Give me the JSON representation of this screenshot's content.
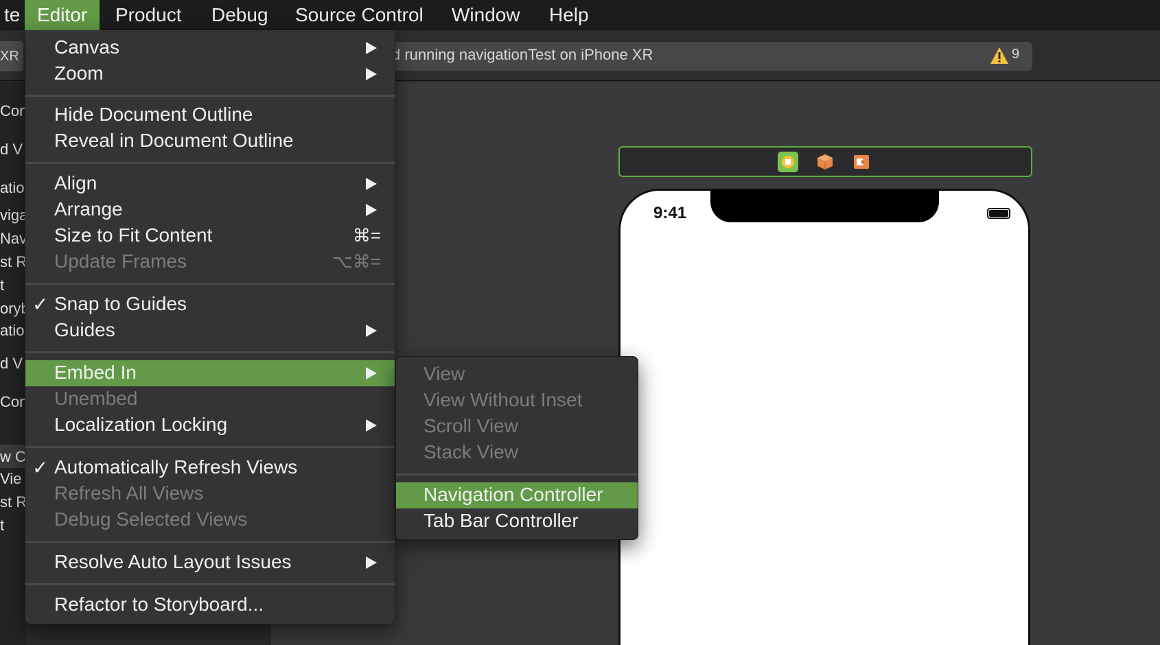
{
  "menubar": {
    "items": [
      {
        "label": "te"
      },
      {
        "label": "Editor"
      },
      {
        "label": "Product"
      },
      {
        "label": "Debug"
      },
      {
        "label": "Source Control"
      },
      {
        "label": "Window"
      },
      {
        "label": "Help"
      }
    ]
  },
  "toolbar": {
    "scheme_chip": "XR",
    "activity_text": "d running navigationTest on iPhone XR",
    "warning_count": "9"
  },
  "navigator": {
    "rows": [
      "Con",
      "d V",
      "atio",
      "viga",
      "Nav",
      "st R",
      "t",
      "oryb",
      "atio",
      "d V",
      "Con",
      "w C",
      "Vie",
      "st R",
      "t"
    ]
  },
  "editor_menu": {
    "items": [
      {
        "label": "Canvas",
        "submenu": true
      },
      {
        "label": "Zoom",
        "submenu": true
      },
      {
        "label": "Hide Document Outline"
      },
      {
        "label": "Reveal in Document Outline"
      },
      {
        "label": "Align",
        "submenu": true
      },
      {
        "label": "Arrange",
        "submenu": true
      },
      {
        "label": "Size to Fit Content",
        "shortcut": "⌘="
      },
      {
        "label": "Update Frames",
        "shortcut": "⌥⌘=",
        "disabled": true
      },
      {
        "label": "Snap to Guides",
        "checked": true
      },
      {
        "label": "Guides",
        "submenu": true
      },
      {
        "label": "Embed In",
        "submenu": true,
        "selected": true
      },
      {
        "label": "Unembed",
        "disabled": true
      },
      {
        "label": "Localization Locking",
        "submenu": true
      },
      {
        "label": "Automatically Refresh Views",
        "checked": true
      },
      {
        "label": "Refresh All Views",
        "disabled": true
      },
      {
        "label": "Debug Selected Views",
        "disabled": true
      },
      {
        "label": "Resolve Auto Layout Issues",
        "submenu": true
      },
      {
        "label": "Refactor to Storyboard..."
      }
    ],
    "checkmark": "✓"
  },
  "embed_submenu": {
    "items": [
      {
        "label": "View",
        "disabled": true
      },
      {
        "label": "View Without Inset",
        "disabled": true
      },
      {
        "label": "Scroll View",
        "disabled": true
      },
      {
        "label": "Stack View",
        "disabled": true
      },
      {
        "label": "Navigation Controller",
        "selected": true
      },
      {
        "label": "Tab Bar Controller"
      }
    ]
  },
  "canvas": {
    "status_time": "9:41",
    "dock_icons": [
      "view-controller-icon",
      "first-responder-icon",
      "exit-icon"
    ]
  },
  "colors": {
    "selection_green": "#629a47",
    "menu_bg": "#343436",
    "canvas_bg": "#3a3a3c",
    "warning_yellow": "#f5c242"
  }
}
